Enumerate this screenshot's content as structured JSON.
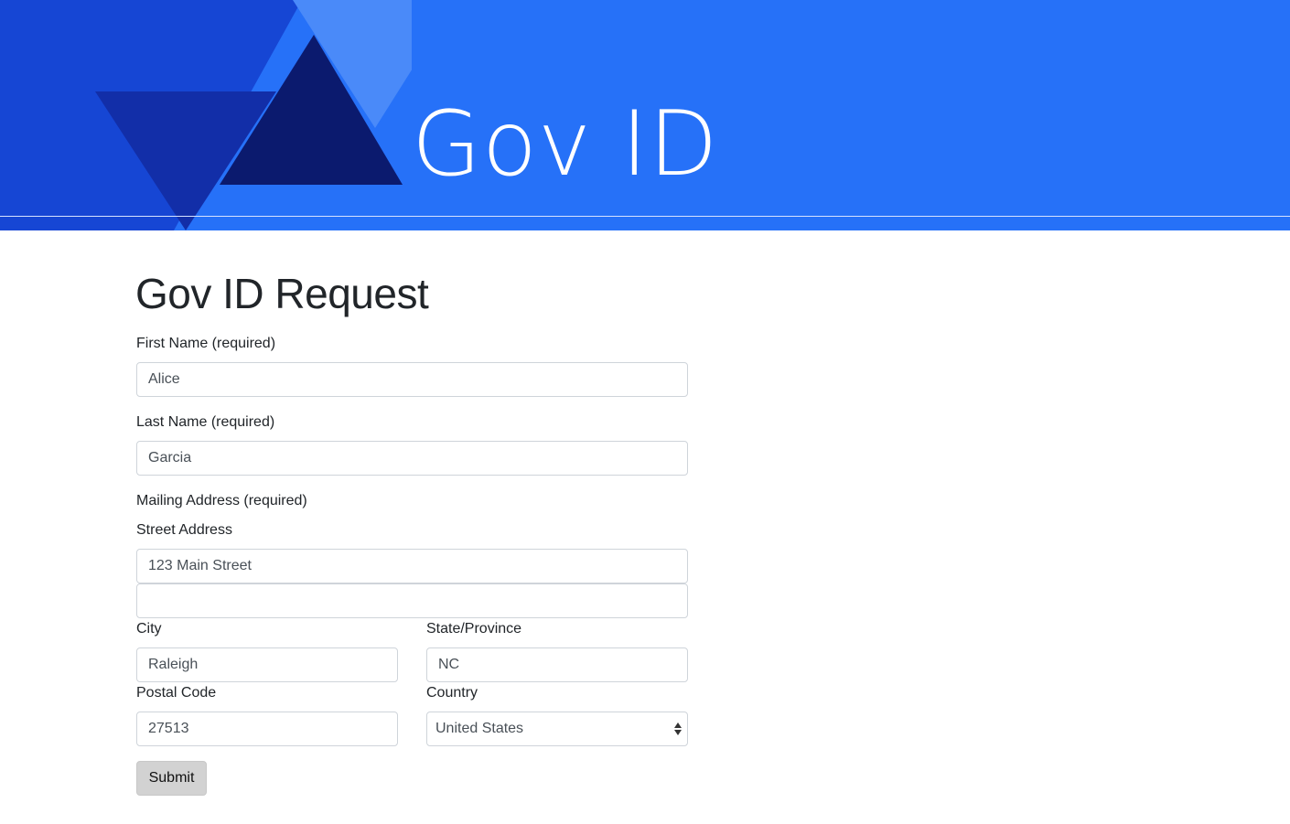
{
  "header": {
    "title": "Gov ID",
    "background_color": "#2671f8",
    "logo_colors": [
      "#1646d4",
      "#122ea8",
      "#0b1a6e",
      "#4a8af9"
    ]
  },
  "page": {
    "title": "Gov ID Request"
  },
  "form": {
    "first_name": {
      "label": "First Name (required)",
      "value": "Alice"
    },
    "last_name": {
      "label": "Last Name (required)",
      "value": "Garcia"
    },
    "mailing_address_label": "Mailing Address (required)",
    "street": {
      "label": "Street Address",
      "line1": "123 Main Street",
      "line2": ""
    },
    "city": {
      "label": "City",
      "value": "Raleigh"
    },
    "state": {
      "label": "State/Province",
      "value": "NC"
    },
    "postal": {
      "label": "Postal Code",
      "value": "27513"
    },
    "country": {
      "label": "Country",
      "selected": "United States"
    },
    "submit_label": "Submit"
  }
}
